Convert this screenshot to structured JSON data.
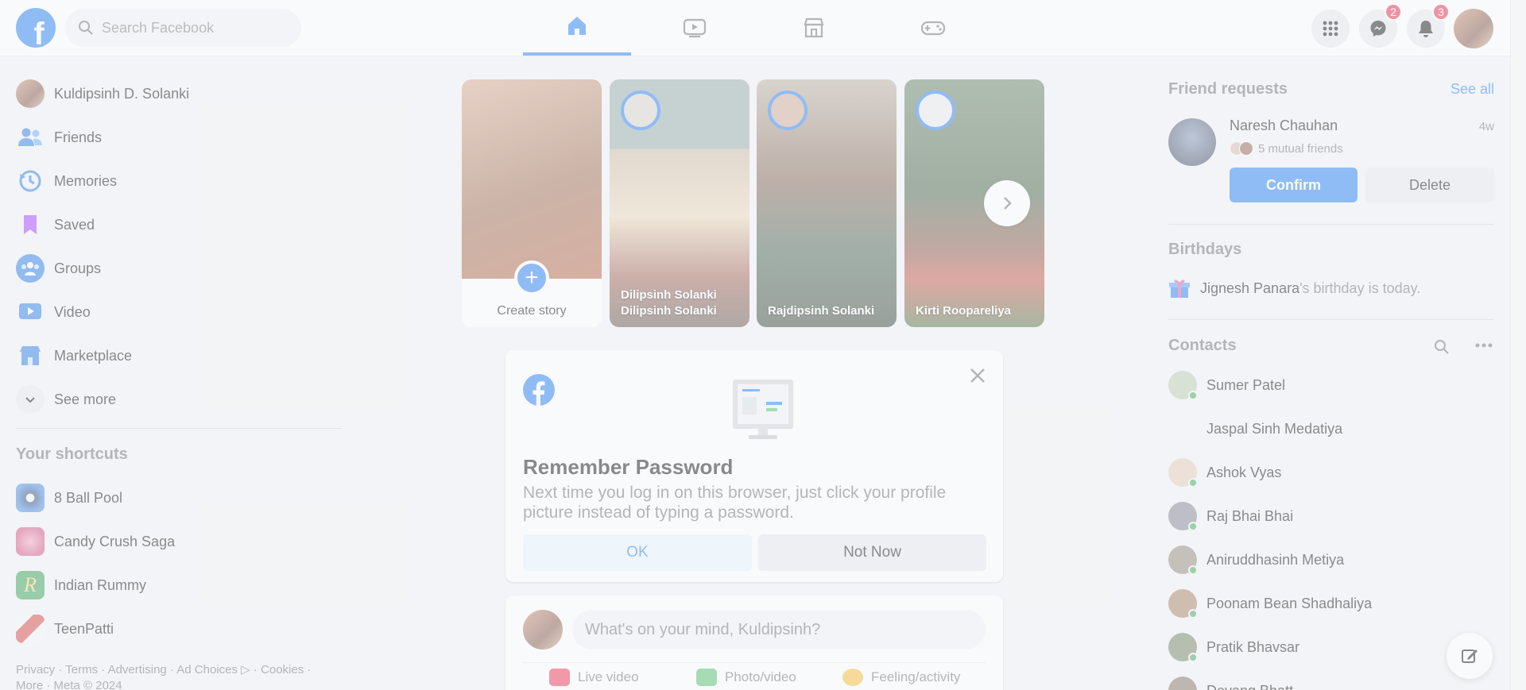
{
  "header": {
    "logo_letter": "f",
    "search_placeholder": "Search Facebook",
    "messenger_badge": "2",
    "notifications_badge": "3"
  },
  "sidebar": {
    "profile_name": "Kuldipsinh D. Solanki",
    "items": [
      {
        "label": "Friends",
        "icon": "friends-icon",
        "color": "#1b74e4"
      },
      {
        "label": "Memories",
        "icon": "memories-icon",
        "color": "#1b74e4"
      },
      {
        "label": "Saved",
        "icon": "saved-icon",
        "color": "#a033ff"
      },
      {
        "label": "Groups",
        "icon": "groups-icon",
        "color": "#1b74e4"
      },
      {
        "label": "Video",
        "icon": "video-icon",
        "color": "#1b74e4"
      },
      {
        "label": "Marketplace",
        "icon": "marketplace-icon",
        "color": "#1b74e4"
      },
      {
        "label": "See more",
        "icon": "chevron-down-icon",
        "color": "#65676b"
      }
    ],
    "shortcuts_title": "Your shortcuts",
    "shortcuts": [
      {
        "label": "8 Ball Pool",
        "color": "#2d6bd1"
      },
      {
        "label": "Candy Crush Saga",
        "color": "#e0608a"
      },
      {
        "label": "Indian Rummy",
        "color": "#2c9a4a"
      },
      {
        "label": "TeenPatti",
        "color": "#d23b3b"
      }
    ],
    "footer_line1": "Privacy · Terms · Advertising · Ad Choices ▷ · Cookies ·",
    "footer_line2": "More · Meta © 2024"
  },
  "stories": {
    "create_label": "Create story",
    "items": [
      {
        "name_line1": "Dilipsinh Solanki",
        "name_line2": "Dilipsinh Solanki"
      },
      {
        "name_line1": "Rajdipsinh Solanki",
        "name_line2": ""
      },
      {
        "name_line1": "Kirti Roopareliya",
        "name_line2": ""
      }
    ]
  },
  "remember_password": {
    "title": "Remember Password",
    "text": "Next time you log in on this browser, just click your profile picture instead of typing a password.",
    "ok_label": "OK",
    "not_now_label": "Not Now"
  },
  "composer": {
    "placeholder": "What's on your mind, Kuldipsinh?",
    "actions": [
      {
        "label": "Live video",
        "color": "#f02849"
      },
      {
        "label": "Photo/video",
        "color": "#45bd62"
      },
      {
        "label": "Feeling/activity",
        "color": "#f7b928"
      }
    ]
  },
  "friend_requests": {
    "title": "Friend requests",
    "see_all": "See all",
    "name": "Naresh Chauhan",
    "time": "4w",
    "mutual": "5 mutual friends",
    "confirm_label": "Confirm",
    "delete_label": "Delete"
  },
  "birthdays": {
    "title": "Birthdays",
    "name": "Jignesh Panara",
    "suffix": "'s birthday is today."
  },
  "contacts": {
    "title": "Contacts",
    "list": [
      {
        "name": "Sumer Patel",
        "online": true
      },
      {
        "name": "Jaspal Sinh Medatiya",
        "online": false
      },
      {
        "name": "Ashok Vyas",
        "online": true
      },
      {
        "name": "Raj Bhai Bhai",
        "online": true
      },
      {
        "name": "Aniruddhasinh Metiya",
        "online": true
      },
      {
        "name": "Poonam Bean Shadhaliya",
        "online": true
      },
      {
        "name": "Pratik Bhavsar",
        "online": true
      },
      {
        "name": "Devang Bhatt",
        "online": false
      }
    ]
  }
}
